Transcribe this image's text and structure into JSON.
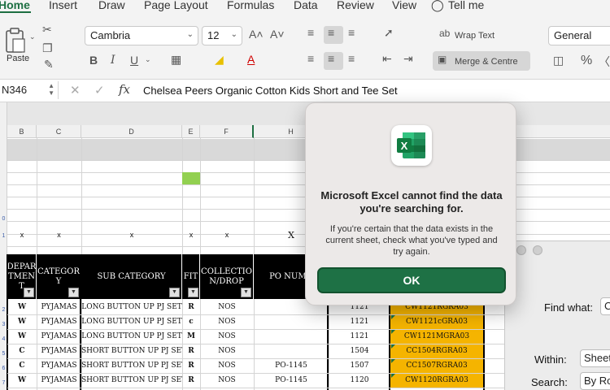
{
  "ribbon_tabs": [
    "Home",
    "Insert",
    "Draw",
    "Page Layout",
    "Formulas",
    "Data",
    "Review",
    "View",
    "Tell me"
  ],
  "ribbon": {
    "paste_label": "Paste",
    "font_name": "Cambria",
    "font_size": "12",
    "wrap_text_label": "Wrap Text",
    "merge_label": "Merge & Centre",
    "number_format": "General",
    "font_grow": "A˄",
    "font_shrink": "A˅"
  },
  "formula_bar": {
    "name_box": "N346",
    "fx": "fx",
    "content": "Chelsea Peers Organic Cotton Kids Short and Tee Set"
  },
  "sheet": {
    "columns": [
      "B",
      "C",
      "D",
      "E",
      "F",
      "H"
    ],
    "row_numbers": [
      "0",
      "1",
      "2",
      "3",
      "4",
      "5",
      "6",
      "7"
    ],
    "marker_row": [
      "x",
      "x",
      "x",
      "x",
      "x",
      "X"
    ],
    "headers": [
      "DEPAR TMEN T",
      "CATEGOR Y",
      "SUB CATEGORY",
      "FIT",
      "COLLECTIO N/DROP",
      "PO NUMB"
    ],
    "rows": [
      {
        "dept": "W",
        "cat": "PYJAMAS",
        "sub": "LONG BUTTON UP PJ SET",
        "fit": "R",
        "coll": "NOS",
        "po": "",
        "num": "1121",
        "code": "CW1121RGRA03"
      },
      {
        "dept": "W",
        "cat": "PYJAMAS",
        "sub": "LONG BUTTON UP PJ SET",
        "fit": "c",
        "coll": "NOS",
        "po": "",
        "num": "1121",
        "code": "CW1121cGRA03"
      },
      {
        "dept": "W",
        "cat": "PYJAMAS",
        "sub": "LONG BUTTON UP PJ SET",
        "fit": "M",
        "coll": "NOS",
        "po": "",
        "num": "1121",
        "code": "CW1121MGRA03"
      },
      {
        "dept": "C",
        "cat": "PYJAMAS",
        "sub": "SHORT BUTTON UP PJ SET",
        "fit": "R",
        "coll": "NOS",
        "po": "",
        "num": "1504",
        "code": "CC1504RGRA03"
      },
      {
        "dept": "C",
        "cat": "PYJAMAS",
        "sub": "SHORT BUTTON UP PJ SET",
        "fit": "R",
        "coll": "NOS",
        "po": "PO-1145",
        "num": "1507",
        "code": "CC1507RGRA03"
      },
      {
        "dept": "W",
        "cat": "PYJAMAS",
        "sub": "SHORT BUTTON UP PJ SET",
        "fit": "R",
        "coll": "NOS",
        "po": "PO-1145",
        "num": "1120",
        "code": "CW1120RGRA03"
      }
    ]
  },
  "find_pane": {
    "find_what_label": "Find what:",
    "find_what_value": "C",
    "within_label": "Within:",
    "within_value": "Sheet",
    "search_label": "Search:",
    "search_value": "By Ro"
  },
  "dialog": {
    "title": "Microsoft Excel cannot find the data you're searching for.",
    "message": "If you're certain that the data exists in the current sheet, check what you've typed and try again.",
    "ok_label": "OK"
  },
  "colors": {
    "excel_green": "#1e7145",
    "highlight_orange": "#f5b400",
    "green_cell": "#92d050"
  }
}
